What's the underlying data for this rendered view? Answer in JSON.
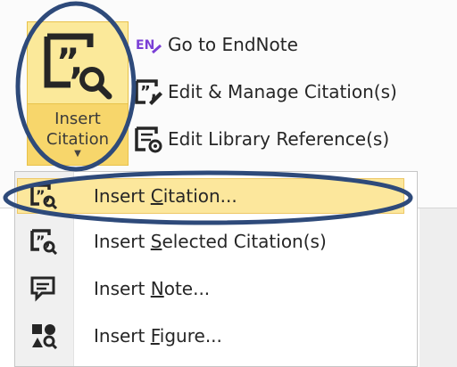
{
  "ribbon": {
    "insert_citation": {
      "line1": "Insert",
      "line2": "Citation"
    },
    "buttons": [
      {
        "label": "Go to EndNote",
        "badge": "EN",
        "icon": "endnote-icon"
      },
      {
        "label": "Edit & Manage Citation(s)",
        "icon": "edit-citation-icon"
      },
      {
        "label": "Edit Library Reference(s)",
        "icon": "edit-library-icon"
      }
    ]
  },
  "menu": {
    "items": [
      {
        "pre": "Insert ",
        "key": "C",
        "post": "itation...",
        "icon": "insert-citation-icon",
        "highlighted": true
      },
      {
        "pre": "Insert ",
        "key": "S",
        "post": "elected Citation(s)",
        "icon": "insert-selected-citation-icon"
      },
      {
        "pre": "Insert ",
        "key": "N",
        "post": "ote...",
        "icon": "insert-note-icon"
      },
      {
        "pre": "Insert ",
        "key": "F",
        "post": "igure...",
        "icon": "insert-figure-icon"
      }
    ]
  },
  "colors": {
    "highlight_fill": "#fce79c",
    "annotation_stroke": "#2e4a7a",
    "endnote_purple": "#7a3fd6"
  }
}
